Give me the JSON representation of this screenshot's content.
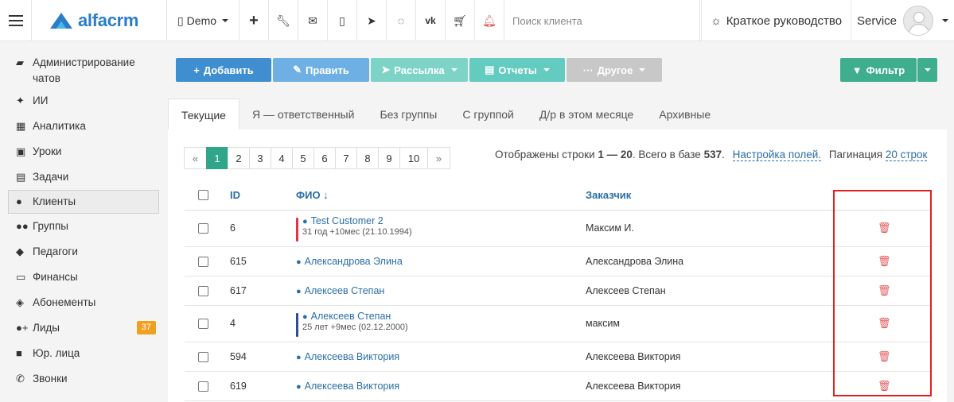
{
  "header": {
    "logo": "alfacrm",
    "branch": "Demo",
    "search_placeholder": "Поиск клиента",
    "guide": "Краткое руководство",
    "user": "Service",
    "icons": [
      "plus-icon",
      "wrench-icon",
      "mail-icon",
      "mobile-icon",
      "telegram-icon",
      "whatsapp-icon",
      "vk-icon",
      "cart-icon",
      "bell-icon"
    ]
  },
  "sidebar": {
    "items": [
      {
        "label": "Администрирование чатов",
        "icon": "chat-icon"
      },
      {
        "label": "ИИ",
        "icon": "sparkle-icon"
      },
      {
        "label": "Аналитика",
        "icon": "map-icon"
      },
      {
        "label": "Уроки",
        "icon": "calendar-icon"
      },
      {
        "label": "Задачи",
        "icon": "clipboard-icon"
      },
      {
        "label": "Клиенты",
        "icon": "user-icon"
      },
      {
        "label": "Группы",
        "icon": "users-icon"
      },
      {
        "label": "Педагоги",
        "icon": "graduation-icon"
      },
      {
        "label": "Финансы",
        "icon": "money-icon"
      },
      {
        "label": "Абонементы",
        "icon": "tag-icon"
      },
      {
        "label": "Лиды",
        "icon": "user-plus-icon",
        "badge": "37"
      },
      {
        "label": "Юр. лица",
        "icon": "briefcase-icon"
      },
      {
        "label": "Звонки",
        "icon": "phone-icon"
      }
    ]
  },
  "toolbar": {
    "add": "Добавить",
    "edit": "Править",
    "mailing": "Рассылка",
    "reports": "Отчеты",
    "other": "Другое",
    "filter": "Фильтр"
  },
  "tabs": [
    "Текущие",
    "Я — ответственный",
    "Без группы",
    "С группой",
    "Д/р в этом месяце",
    "Архивные"
  ],
  "pagination": {
    "prev": "«",
    "next": "»",
    "pages": [
      "1",
      "2",
      "3",
      "4",
      "5",
      "6",
      "7",
      "8",
      "9",
      "10"
    ],
    "current": "1"
  },
  "info": {
    "text1": "Отображены строки ",
    "range": "1 — 20",
    "text2": ". Всего в базе ",
    "total": "537",
    "text3": ".",
    "settings_link": "Настройка полей.",
    "pagination_label": "Пагинация",
    "pagination_link": "20 строк"
  },
  "table": {
    "headers": {
      "id": "ID",
      "name": "ФИО ↓",
      "customer": "Заказчик"
    },
    "rows": [
      {
        "id": "6",
        "name": "Test Customer 2",
        "sub": "31 год +10мес (21.10.1994)",
        "customer": "Максим И.",
        "bar": "#e0344a"
      },
      {
        "id": "615",
        "name": "Александрова Элина",
        "sub": "",
        "customer": "Александрова Элина",
        "bar": ""
      },
      {
        "id": "617",
        "name": "Алексеев Степан",
        "sub": "",
        "customer": "Алексеев Степан",
        "bar": ""
      },
      {
        "id": "4",
        "name": "Алексеев Степан",
        "sub": "25 лет +9мес (02.12.2000)",
        "customer": "максим",
        "bar": "#2f4e8f"
      },
      {
        "id": "594",
        "name": "Алексеева Виктория",
        "sub": "",
        "customer": "Алексеева Виктория",
        "bar": ""
      },
      {
        "id": "619",
        "name": "Алексеева Виктория",
        "sub": "",
        "customer": "Алексеева Виктория",
        "bar": ""
      }
    ]
  },
  "colors": {
    "primary": "#3f8fd0",
    "accent": "#2fa58a",
    "danger": "#e05a5a",
    "highlight": "#e02020"
  }
}
